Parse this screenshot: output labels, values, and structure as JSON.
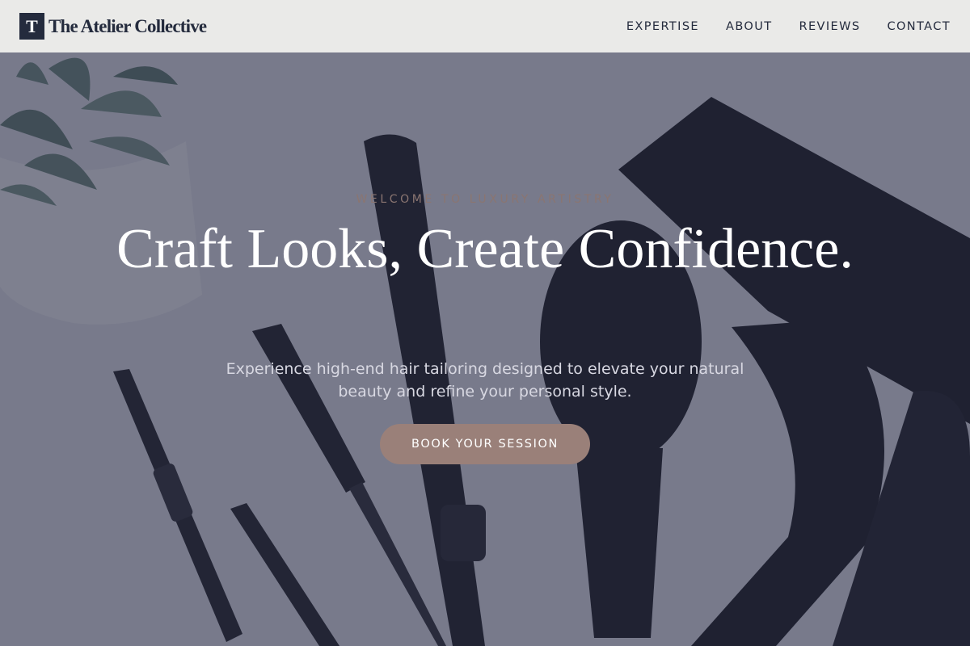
{
  "header": {
    "logo_letter": "T",
    "brand_name": "The Atelier Collective",
    "nav": [
      {
        "label": "EXPERTISE"
      },
      {
        "label": "ABOUT"
      },
      {
        "label": "REVIEWS"
      },
      {
        "label": "CONTACT"
      }
    ]
  },
  "hero": {
    "eyebrow": "WELCOME TO LUXURY ARTISTRY",
    "headline": "Craft Looks, Create Confidence.",
    "subtext": "Experience high-end hair tailoring designed to elevate your natural beauty and refine your personal style.",
    "cta_label": "BOOK YOUR SESSION"
  },
  "colors": {
    "header_bg": "#eaeae8",
    "brand": "#242b3d",
    "accent": "#9a8079",
    "eyebrow": "#8a7571",
    "overlay": "#2a2d46"
  },
  "icons": {
    "logo": "letter-t-logo"
  }
}
